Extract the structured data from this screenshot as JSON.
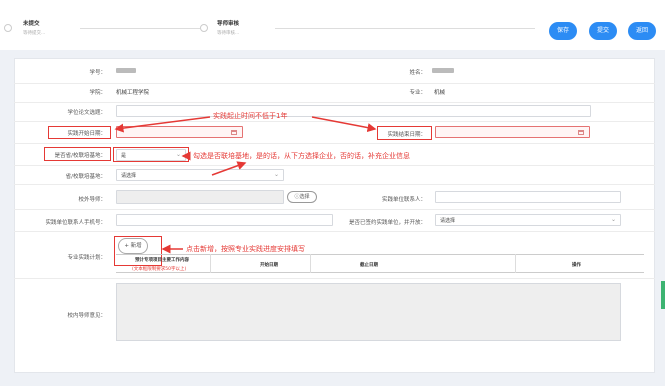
{
  "header": {
    "steps": [
      {
        "title": "未提交",
        "sub": "等待提交..."
      },
      {
        "title": "导师审核",
        "sub": "等待审核..."
      }
    ],
    "buttons": {
      "save": "保存",
      "submit": "提交",
      "back": "返回"
    }
  },
  "form": {
    "student_id": {
      "label": "学号："
    },
    "name": {
      "label": "姓名："
    },
    "college": {
      "label": "学院：",
      "value": "机械工程学院"
    },
    "major": {
      "label": "专业：",
      "value": "机械"
    },
    "thesis_title": {
      "label": "学位论文选题："
    },
    "start_date": {
      "label": "实践开始日期："
    },
    "end_date": {
      "label": "实践结束日期："
    },
    "is_joint_base": {
      "label": "是否省/校联培基地：",
      "value": "是"
    },
    "base": {
      "label": "省/校联培基地：",
      "value": "请选择"
    },
    "external_tutor": {
      "label": "校外导师：",
      "pill": "ⓘ选择"
    },
    "practice_contact": {
      "label": "实践单位联系人："
    },
    "contact_phone": {
      "label": "实践单位联系人手机号："
    },
    "signed_agreement": {
      "label": "是否已签约实践单位，并开放：",
      "value": "请选择"
    },
    "plan": {
      "label": "专业实践计划：",
      "new_button": "+ 新增",
      "columns": [
        "预计专项项目主要工作内容",
        "开始日期",
        "截止日期",
        "操作"
      ],
      "column_note": "(文本框限制要求50字以上)"
    },
    "tutor_opinion": {
      "label": "校内导师意见："
    }
  },
  "annotations": {
    "a1": "实践起止时间不低于1年",
    "a2": "勾选是否联培基地，是的话，从下方选择企业，否的话，补充企业信息",
    "a3": "点击新增，按照专业实践进度安排填写"
  },
  "colors": {
    "primary": "#2c8cf4",
    "annotation": "#e53935"
  }
}
